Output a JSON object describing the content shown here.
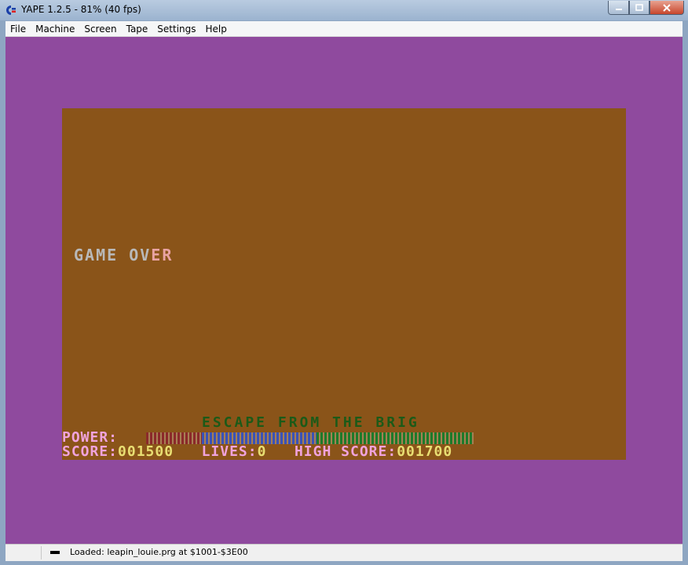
{
  "window": {
    "title": "YAPE 1.2.5 - 81% (40 fps)"
  },
  "menu": [
    "File",
    "Machine",
    "Screen",
    "Tape",
    "Settings",
    "Help"
  ],
  "game": {
    "game_over_main": "GAME OV",
    "game_over_accent": "ER",
    "level_title": "ESCAPE FROM THE BRIG",
    "power_label": "POWER:",
    "score_label": "SCORE:",
    "score_value": "001500",
    "lives_label": "LIVES:",
    "lives_value": "0",
    "high_label": "HIGH SCORE:",
    "high_value": "001700"
  },
  "power_bar": {
    "segments": [
      {
        "color": "#8b2a2a",
        "fraction": 0.17
      },
      {
        "color": "#3b52b5",
        "fraction": 0.35
      },
      {
        "color": "#1f7a2a",
        "fraction": 0.48
      }
    ]
  },
  "status": {
    "text": "Loaded: leapin_louie.prg at $1001-$3E00"
  }
}
